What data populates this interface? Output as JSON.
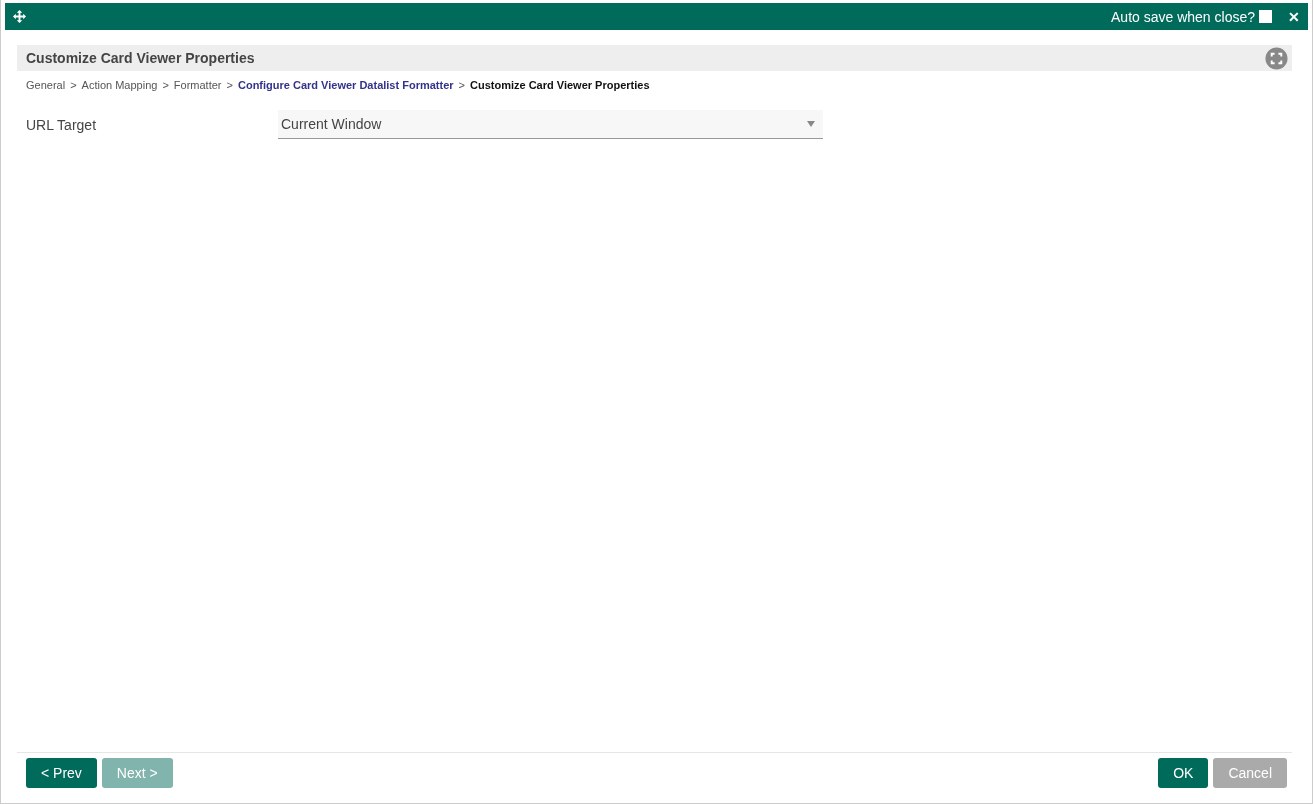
{
  "title_bar": {
    "autosave_label": "Auto save when close?",
    "autosave_checked": false,
    "close": "✕"
  },
  "panel": {
    "title": "Customize Card Viewer Properties"
  },
  "breadcrumb": [
    {
      "label": "General",
      "kind": "plain"
    },
    {
      "label": ">",
      "kind": "separator"
    },
    {
      "label": "Action Mapping",
      "kind": "plain"
    },
    {
      "label": ">",
      "kind": "separator"
    },
    {
      "label": "Formatter",
      "kind": "plain"
    },
    {
      "label": ">",
      "kind": "separator"
    },
    {
      "label": "Configure Card Viewer Datalist Formatter",
      "kind": "link"
    },
    {
      "label": ">",
      "kind": "separator"
    },
    {
      "label": "Customize Card Viewer Properties",
      "kind": "current"
    }
  ],
  "fields": [
    {
      "label": "URL Target",
      "value": "Current Window"
    }
  ],
  "buttons_left": [
    {
      "label": "< Prev",
      "kind": "primary",
      "disabled": false
    },
    {
      "label": "Next >",
      "kind": "primary",
      "disabled": true
    }
  ],
  "buttons_right": [
    {
      "label": "OK",
      "kind": "primary",
      "disabled": false
    },
    {
      "label": "Cancel",
      "kind": "secondary",
      "disabled": false
    }
  ]
}
